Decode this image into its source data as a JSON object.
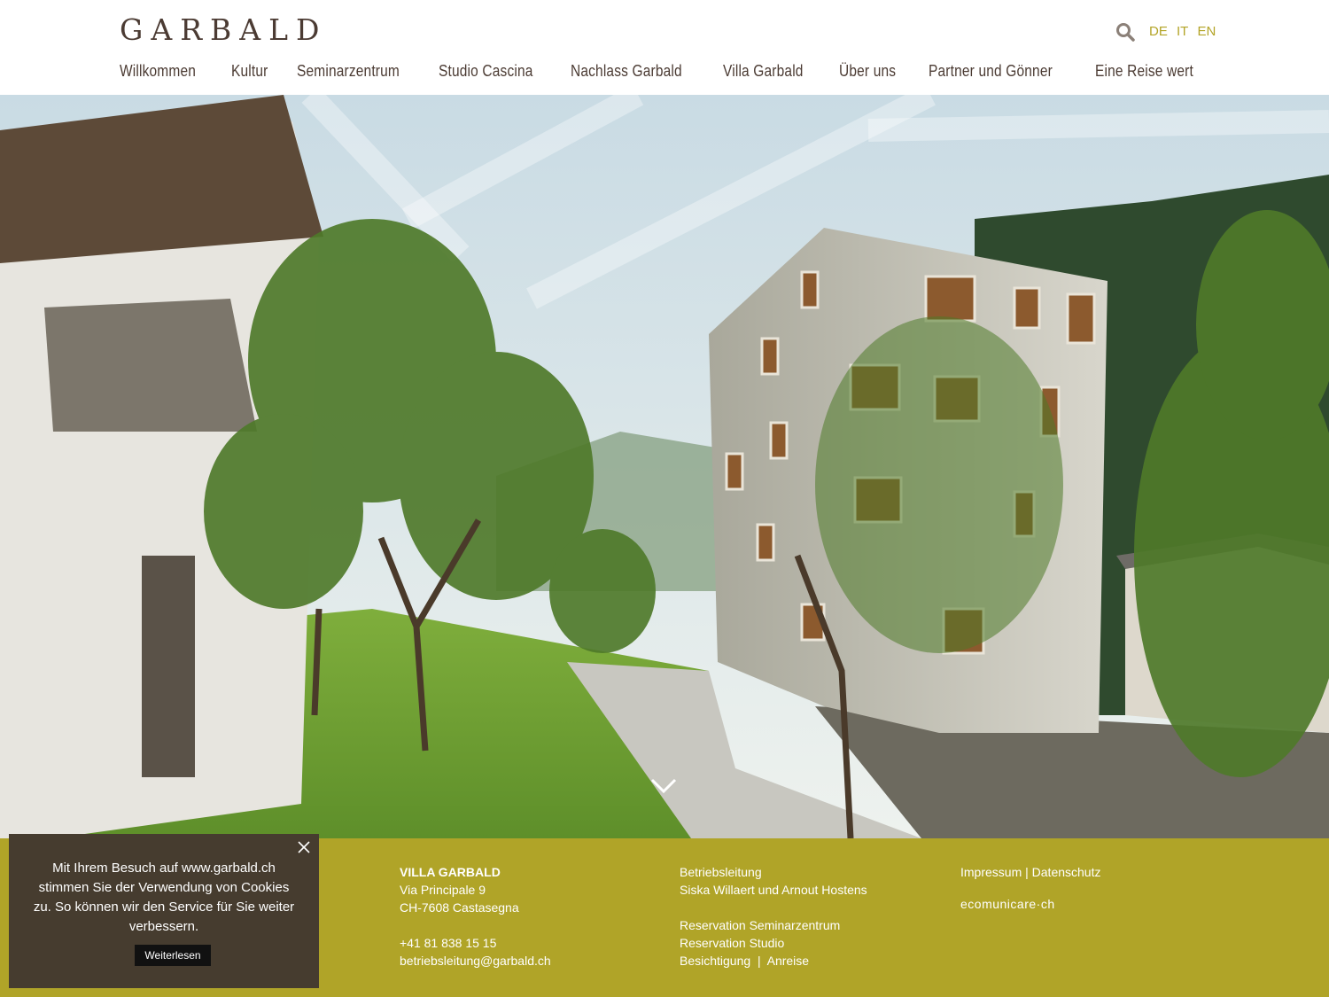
{
  "header": {
    "logo": "GARBALD",
    "languages": [
      "DE",
      "IT",
      "EN"
    ],
    "nav": [
      "Willkommen",
      "Kultur",
      "Seminarzentrum",
      "Studio Cascina",
      "Nachlass Garbald",
      "Villa Garbald",
      "Über uns",
      "Partner und Gönner",
      "Eine Reise wert"
    ]
  },
  "hero": {
    "icon": "chevron-down-icon"
  },
  "footer": {
    "address": {
      "title": "VILLA GARBALD",
      "street": "Via Principale 9",
      "city": "CH-7608 Castasegna",
      "phone": "+41 81 838 15 15",
      "email": "betriebsleitung@garbald.ch"
    },
    "management": {
      "title": "Betriebsleitung",
      "names": "Siska Willaert und Arnout Hostens",
      "link1": "Reservation Seminarzentrum",
      "link2": "Reservation Studio",
      "link3": "Besichtigung",
      "separator": "|",
      "link4": "Anreise"
    },
    "legal": {
      "impressum": "Impressum",
      "separator": "|",
      "datenschutz": "Datenschutz",
      "credit": "ecomunicare·ch"
    },
    "colors": {
      "background": "#b0a428"
    }
  },
  "cookie": {
    "text": "Mit Ihrem Besuch auf www.garbald.ch stimmen Sie der Verwendung von Cookies zu. So können wir den Service für Sie weiter verbessern.",
    "button": "Weiterlesen"
  }
}
